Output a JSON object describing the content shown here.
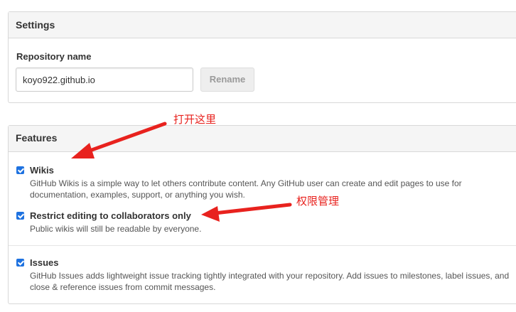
{
  "settings": {
    "header": "Settings",
    "repo_name_label": "Repository name",
    "repo_name_value": "koyo922.github.io",
    "rename_label": "Rename"
  },
  "features": {
    "header": "Features",
    "items": [
      {
        "title": "Wikis",
        "checked": true,
        "desc_lines": [
          "GitHub Wikis is a simple way to let others contribute content. Any GitHub user can create and edit pages to use for",
          "documentation, examples, support, or anything you wish."
        ]
      },
      {
        "title": "Restrict editing to collaborators only",
        "checked": true,
        "desc_lines": [
          "Public wikis will still be readable by everyone."
        ]
      },
      {
        "title": "Issues",
        "checked": true,
        "desc_lines": [
          "GitHub Issues adds lightweight issue tracking tightly integrated with your repository. Add issues to milestones, label issues, and",
          "close & reference issues from commit messages."
        ]
      }
    ]
  },
  "annotations": {
    "open_here": "打开这里",
    "permissions": "权限管理"
  },
  "colors": {
    "annotation": "#e8221e",
    "checkbox": "#1e72e0"
  }
}
